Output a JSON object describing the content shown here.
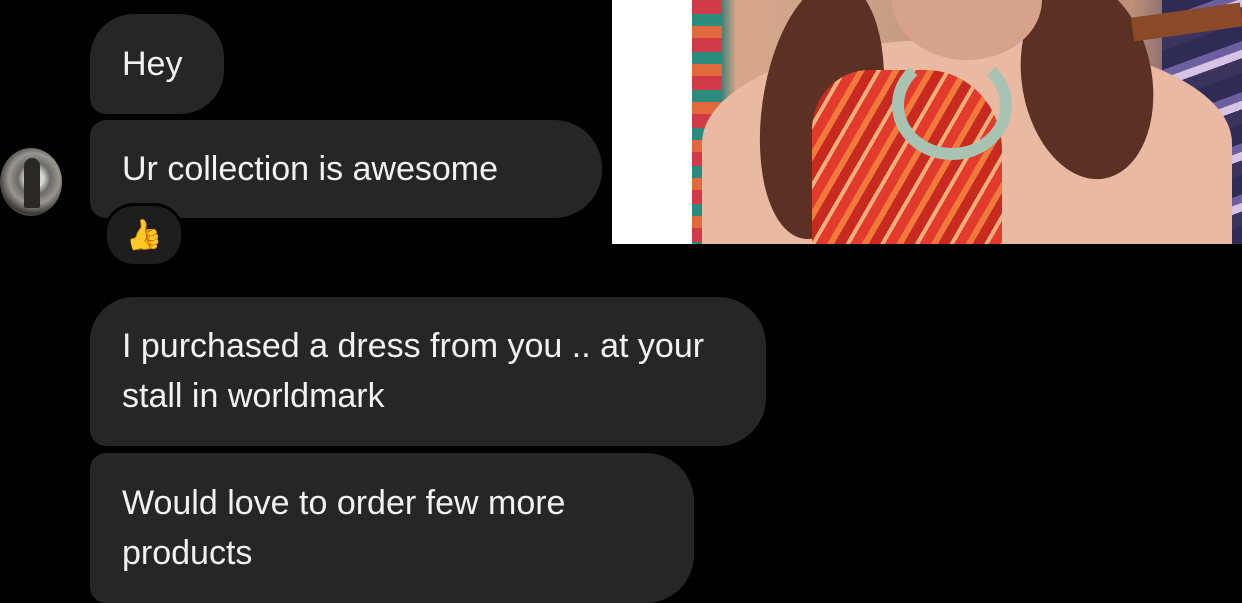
{
  "messages": [
    {
      "text": "Hey"
    },
    {
      "text": "Ur collection is awesome",
      "reaction": "thumbs-up"
    },
    {
      "text": "I purchased a dress from you .. at your stall in worldmark"
    },
    {
      "text": "Would love to order few more products"
    }
  ],
  "reaction_emoji": "👍",
  "sender_avatar": "avatar-image",
  "attached_photo": "photo-of-woman-in-red-dress",
  "colors": {
    "background": "#000000",
    "bubble": "#262626",
    "text": "#f2f2f2",
    "reaction": "#f3c23d"
  }
}
